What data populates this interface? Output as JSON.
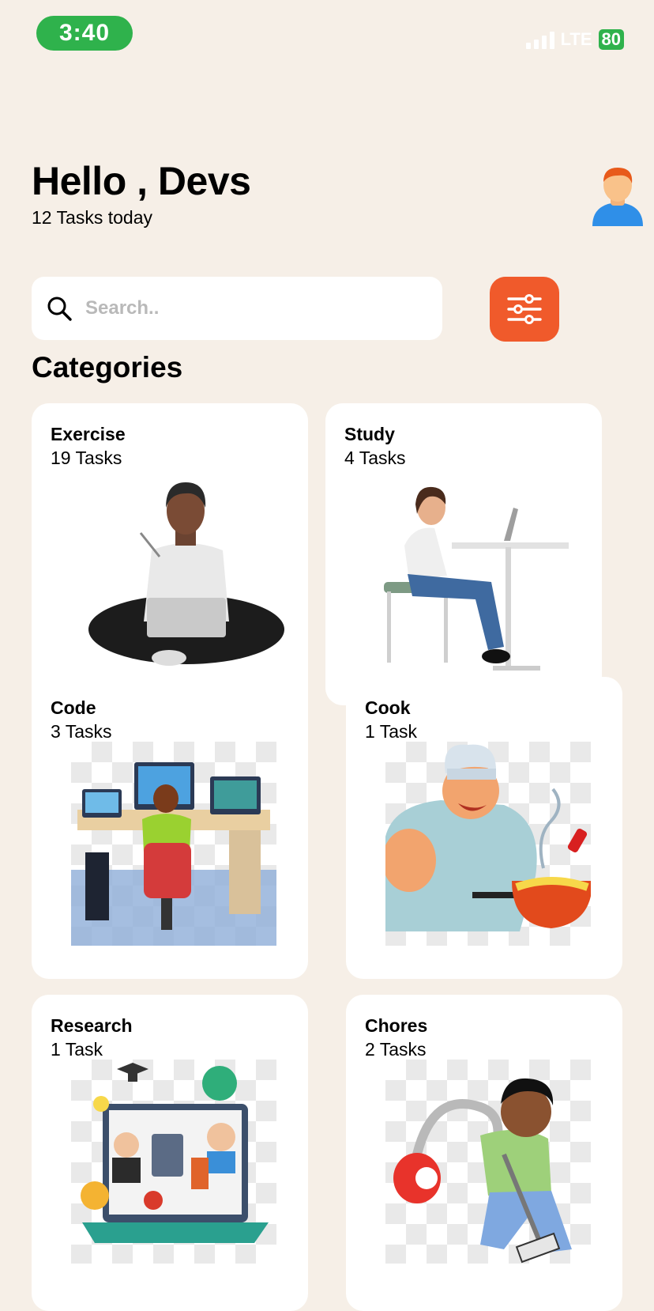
{
  "status_bar": {
    "time": "3:40",
    "network": "LTE",
    "battery": "80"
  },
  "header": {
    "greeting": "Hello , Devs",
    "subtitle": "12 Tasks today",
    "avatar_icon": "user-avatar-icon"
  },
  "search": {
    "placeholder": "Search..",
    "value": ""
  },
  "filter_icon": "sliders-icon",
  "section_title": "Categories",
  "categories": [
    {
      "name": "Exercise",
      "count": "19 Tasks"
    },
    {
      "name": "Study",
      "count": "4 Tasks"
    },
    {
      "name": "Code",
      "count": "3 Tasks"
    },
    {
      "name": "Cook",
      "count": "1 Task"
    },
    {
      "name": "Research",
      "count": "1 Task"
    },
    {
      "name": "Chores",
      "count": "2 Tasks"
    }
  ],
  "colors": {
    "background": "#f6efe7",
    "accent": "#f05a2b",
    "time_pill": "#2fb24c"
  }
}
